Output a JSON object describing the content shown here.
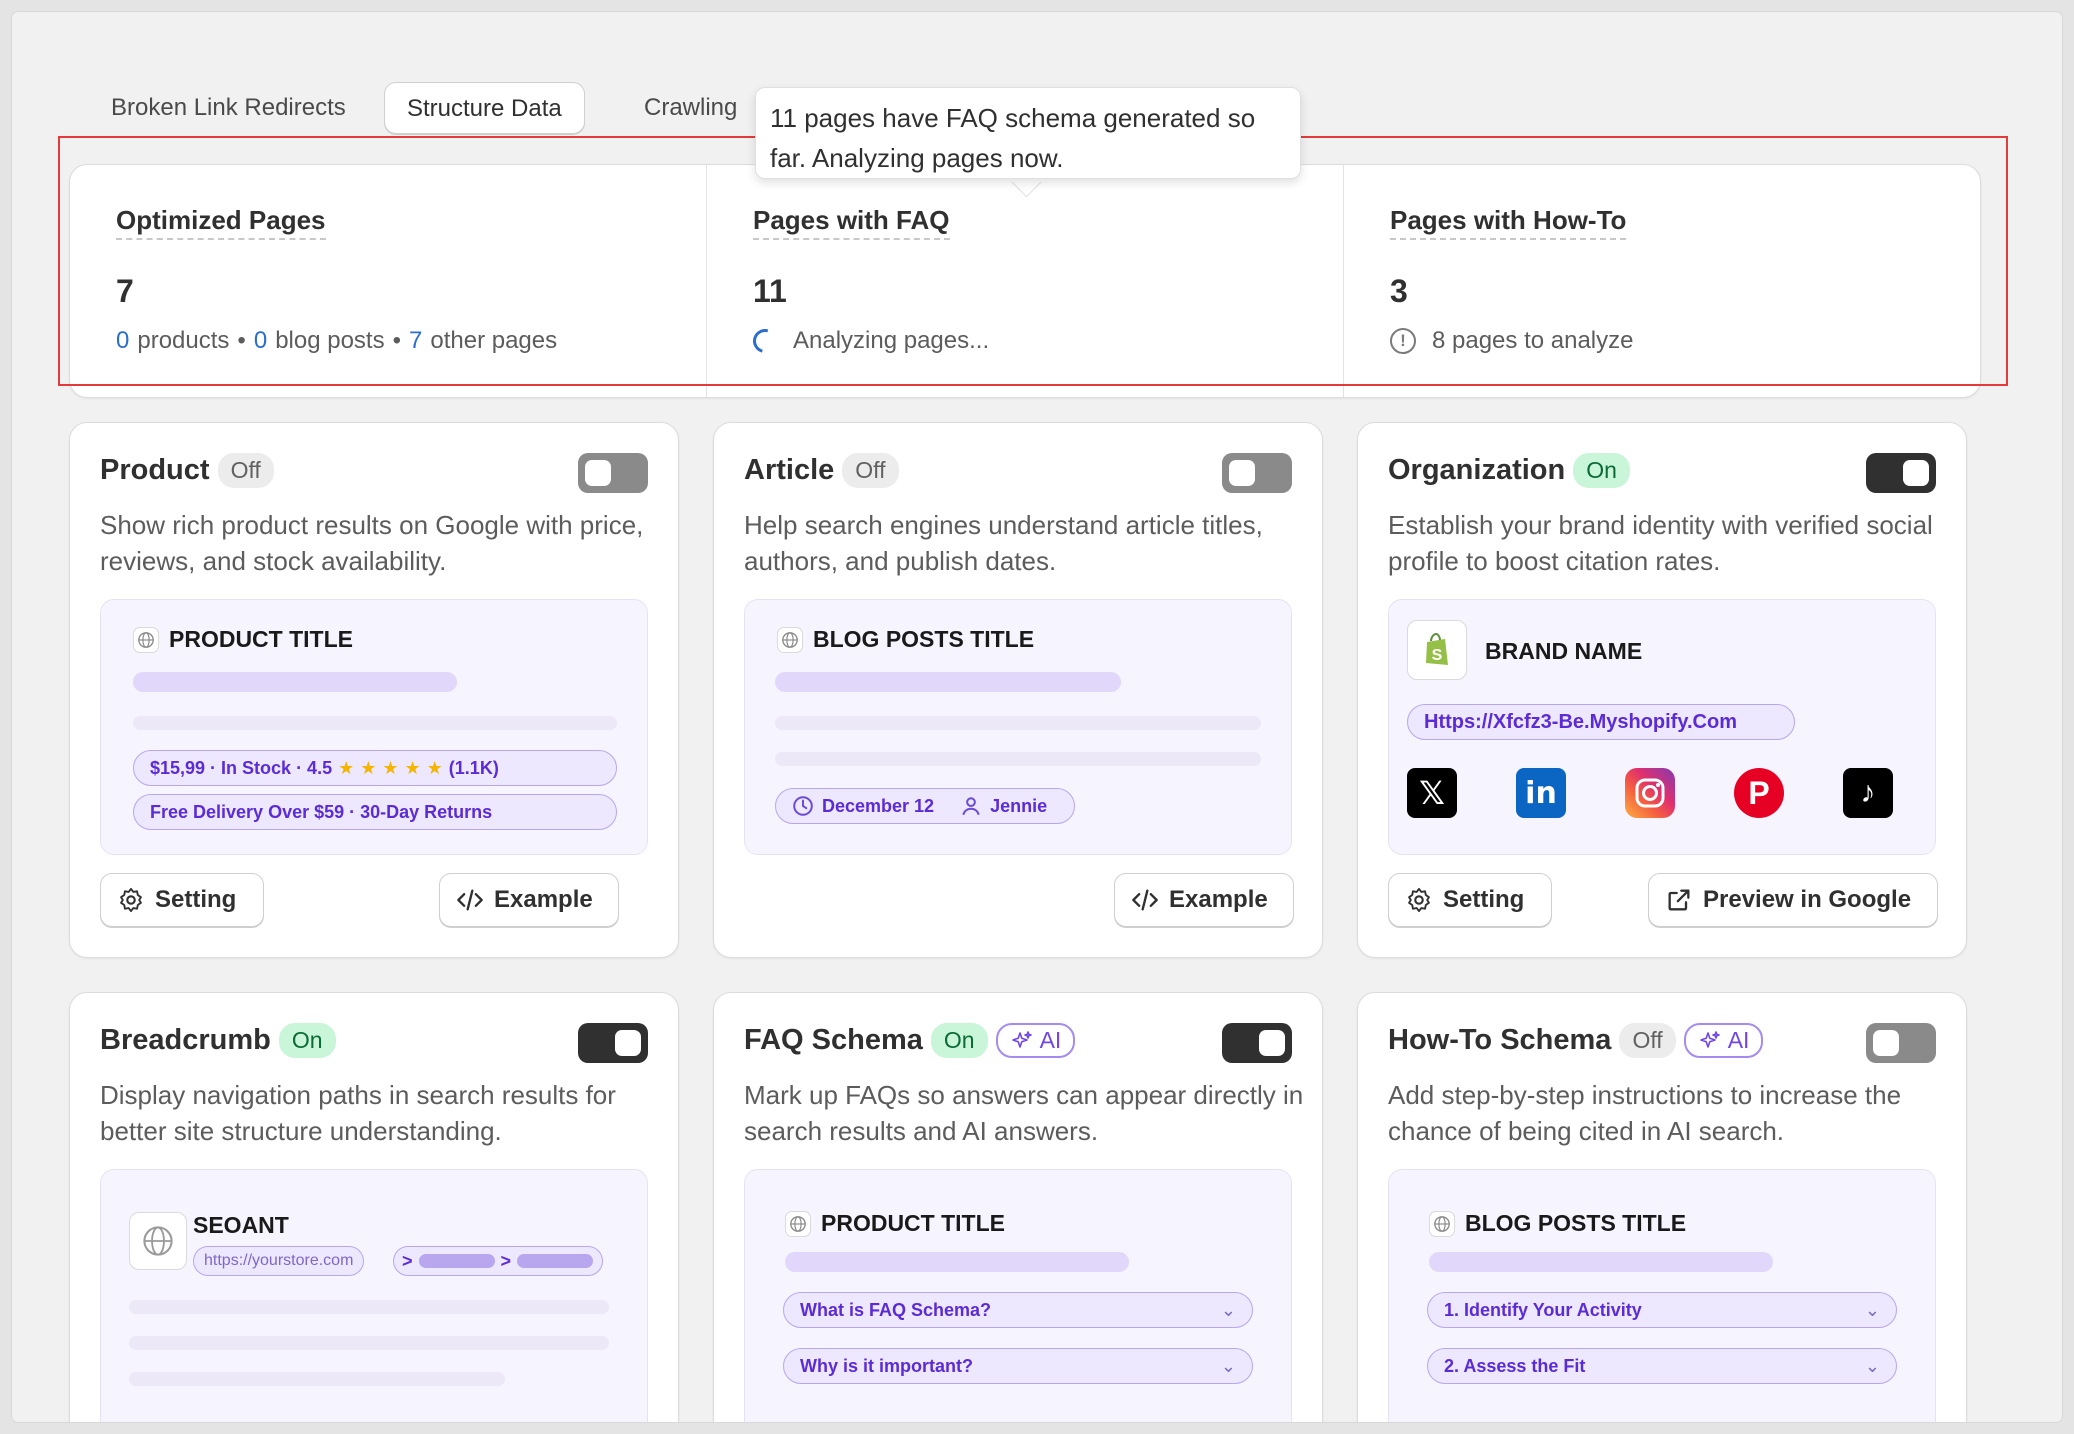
{
  "tabs": [
    "Broken Link Redirects",
    "Structure Data",
    "Crawling"
  ],
  "tooltip": {
    "line1": "11 pages have FAQ schema generated so",
    "line2": "far. Analyzing pages now."
  },
  "stats": {
    "optimized": {
      "label": "Optimized Pages",
      "value": "7",
      "products_count": "0",
      "products_label": "products",
      "blog_count": "0",
      "blog_label": "blog posts",
      "other_count": "7",
      "other_label": "other pages",
      "sep": "•"
    },
    "faq": {
      "label": "Pages with FAQ",
      "value": "11",
      "status": "Analyzing pages..."
    },
    "howto": {
      "label": "Pages with How-To",
      "value": "3",
      "status": "8 pages to analyze"
    }
  },
  "cards": {
    "product": {
      "title": "Product",
      "status": "Off",
      "desc": "Show rich product results on Google with price, reviews, and stock availability.",
      "preview_title": "PRODUCT TITLE",
      "pill1": "$15,99 · In Stock · 4.5",
      "rating_count": "(1.1K)",
      "pill2": "Free Delivery Over $59 · 30-Day Returns",
      "setting": "Setting",
      "example": "Example"
    },
    "article": {
      "title": "Article",
      "status": "Off",
      "desc": "Help search engines understand article titles, authors, and publish dates.",
      "preview_title": "BLOG POSTS TITLE",
      "date": "December 12",
      "author": "Jennie",
      "example": "Example"
    },
    "organization": {
      "title": "Organization",
      "status": "On",
      "desc": "Establish your brand identity with verified social profile to boost citation rates.",
      "brand": "BRAND NAME",
      "url": "Https://Xfcfz3-Be.Myshopify.Com",
      "setting": "Setting",
      "preview": "Preview in Google"
    },
    "breadcrumb": {
      "title": "Breadcrumb",
      "status": "On",
      "desc": "Display navigation paths in search results for better site structure understanding.",
      "site": "SEOANT",
      "url": "https://yourstore.com",
      "sep": ">"
    },
    "faq": {
      "title": "FAQ Schema",
      "status": "On",
      "ai": "AI",
      "desc": "Mark up FAQs so answers can appear directly in search results and AI answers.",
      "preview_title": "PRODUCT TITLE",
      "q1": "What is FAQ Schema?",
      "q2": "Why is it important?"
    },
    "howto": {
      "title": "How-To Schema",
      "status": "Off",
      "ai": "AI",
      "desc": "Add step-by-step instructions to increase the chance of being cited in AI search.",
      "preview_title": "BLOG POSTS TITLE",
      "s1": "1. Identify Your Activity",
      "s2": "2. Assess the Fit"
    }
  }
}
